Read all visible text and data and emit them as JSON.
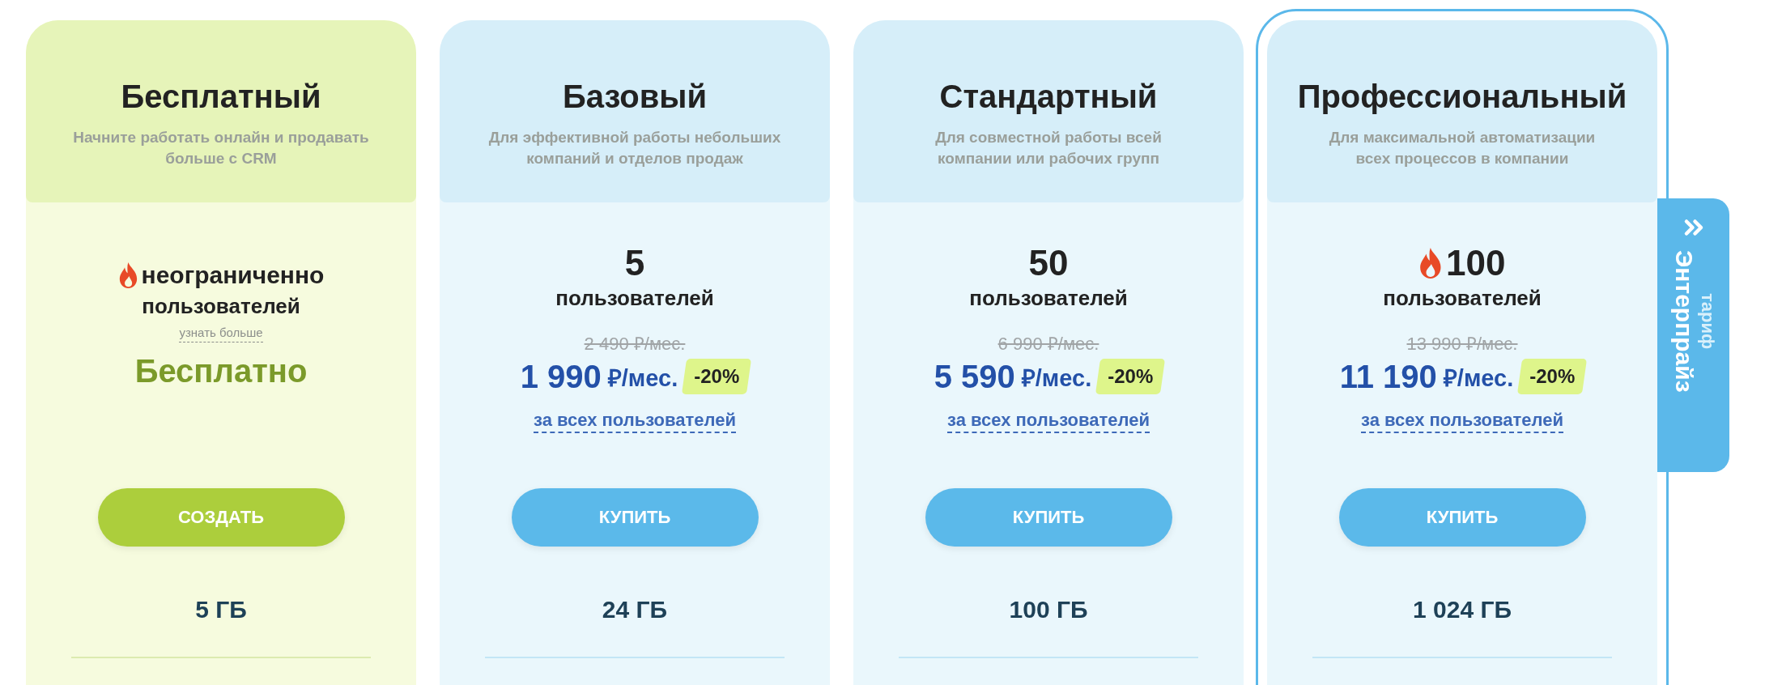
{
  "plans": [
    {
      "kind": "free",
      "highlighted": false,
      "title": "Бесплатный",
      "subtitle": "Начните работать онлайн и продавать больше с CRM",
      "hot": true,
      "users_value": "неограниченно",
      "users_label": "пользователей",
      "learn_more": "узнать больше",
      "price": "Бесплатно",
      "button": "СОЗДАТЬ",
      "storage": "5 ГБ"
    },
    {
      "kind": "paid",
      "highlighted": false,
      "title": "Базовый",
      "subtitle": "Для эффективной работы небольших компаний и отделов продаж",
      "hot": false,
      "users_value": "5",
      "users_label": "пользователей",
      "old_price": "2 490 ₽/мес.",
      "price": "1 990",
      "price_unit": "₽/мес.",
      "discount": "-20%",
      "per_users": "за всех пользователей",
      "button": "КУПИТЬ",
      "storage": "24 ГБ"
    },
    {
      "kind": "paid",
      "highlighted": false,
      "title": "Стандартный",
      "subtitle": "Для совместной работы всей компании или рабочих групп",
      "hot": false,
      "users_value": "50",
      "users_label": "пользователей",
      "old_price": "6 990 ₽/мес.",
      "price": "5 590",
      "price_unit": "₽/мес.",
      "discount": "-20%",
      "per_users": "за всех пользователей",
      "button": "КУПИТЬ",
      "storage": "100 ГБ"
    },
    {
      "kind": "paid",
      "highlighted": true,
      "title": "Профессиональный",
      "subtitle": "Для максимальной автоматизации всех процессов в компании",
      "hot": true,
      "users_value": "100",
      "users_label": "пользователей",
      "old_price": "13 990 ₽/мес.",
      "price": "11 190",
      "price_unit": "₽/мес.",
      "discount": "-20%",
      "per_users": "за всех пользователей",
      "button": "КУПИТЬ",
      "storage": "1 024 ГБ"
    }
  ],
  "side_tab": {
    "label": "тариф",
    "title": "Энтерпрайз"
  }
}
